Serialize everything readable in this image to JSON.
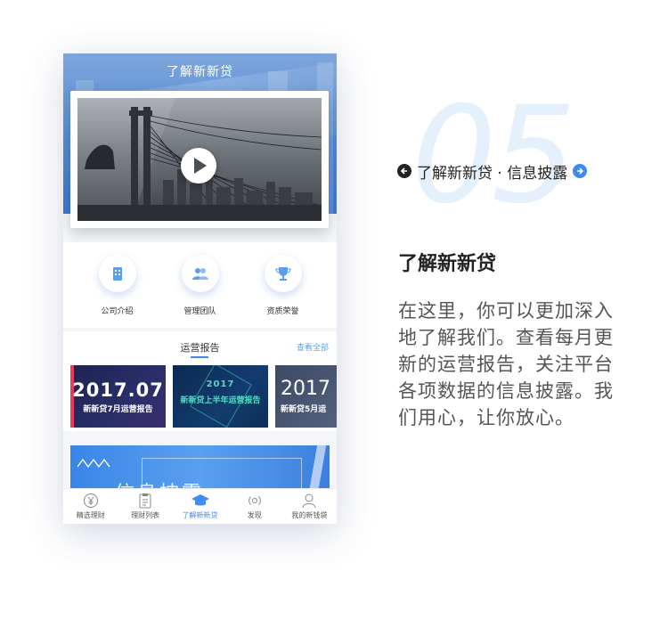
{
  "phone": {
    "nav_title": "了解新新贷",
    "quick_links": [
      {
        "label": "公司介绍",
        "icon": "building-icon"
      },
      {
        "label": "管理团队",
        "icon": "team-icon"
      },
      {
        "label": "资质荣誉",
        "icon": "trophy-icon"
      }
    ],
    "reports": {
      "title": "运营报告",
      "view_all": "查看全部",
      "cards": [
        {
          "year": "2017.07",
          "subtitle": "新新贷7月运营报告"
        },
        {
          "year": "2017",
          "subtitle": "新新贷上半年运营报告"
        },
        {
          "year": "2017",
          "subtitle": "新新贷5月运"
        }
      ]
    },
    "banner_text": "信息披露",
    "tabs": [
      {
        "label": "精选理财",
        "icon": "yen-coin-icon",
        "active": false
      },
      {
        "label": "理财列表",
        "icon": "clipboard-icon",
        "active": false
      },
      {
        "label": "了解新新贷",
        "icon": "graduation-cap-icon",
        "active": true
      },
      {
        "label": "发现",
        "icon": "radar-icon",
        "active": false
      },
      {
        "label": "我的新钱袋",
        "icon": "user-icon",
        "active": false
      }
    ]
  },
  "page": {
    "deco_number": "05",
    "breadcrumb": "了解新新贷 · 信息披露",
    "feature_title": "了解新新贷",
    "feature_body": "在这里，你可以更加深入地了解我们。查看每月更新的运营报告，关注平台各项数据的信息披露。我们用心，让你放心。"
  },
  "colors": {
    "accent": "#3d8af0",
    "header_blue": "#4f86d4",
    "deco_number": "#e4f0fb"
  }
}
